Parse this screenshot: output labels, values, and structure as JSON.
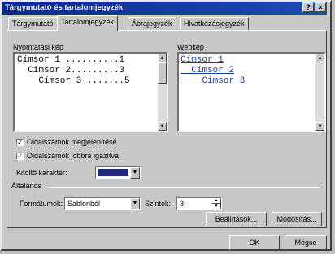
{
  "window": {
    "title": "Tárgymutató és tartalomjegyzék",
    "help_label": "?",
    "close_label": "×"
  },
  "tabs": [
    {
      "label": "Tárgymutató"
    },
    {
      "label": "Tartalomjegyzék",
      "active": true
    },
    {
      "label": "Ábrajegyzék"
    },
    {
      "label": "Hivatkozásjegyzék"
    }
  ],
  "print_preview": {
    "label": "Nyomtatási kép",
    "lines": [
      "Címsor 1 ..........1",
      "  Címsor 2.........3",
      "    Címsor 3 .......5"
    ]
  },
  "web_preview": {
    "label": "Webkép",
    "lines": [
      "Címsor 1",
      "  Címsor 2",
      "    Címsor 3"
    ]
  },
  "options": {
    "show_page_numbers": {
      "label": "Oldalszámok megjelenítése",
      "checked": true
    },
    "right_align": {
      "label": "Oldalszámok jobbra igazítva",
      "checked": true
    },
    "leader_label": "Kitöltő karakter:",
    "leader_value": ""
  },
  "general": {
    "label": "Általános",
    "formats_label": "Formátumok:",
    "formats_value": "Sablonból",
    "levels_label": "Szintek:",
    "levels_value": "3"
  },
  "buttons": {
    "settings": "Beállítások...",
    "modify": "Módosítás...",
    "ok": "OK",
    "cancel": "Mégse"
  }
}
